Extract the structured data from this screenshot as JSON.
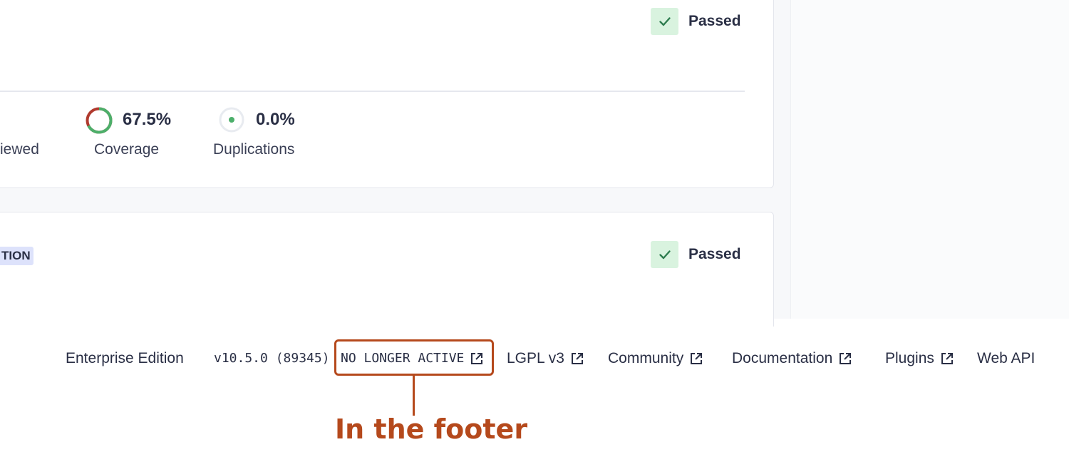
{
  "quality_gate_top": {
    "status": "Passed"
  },
  "metrics": {
    "partial_label": "iewed",
    "coverage": {
      "value": "67.5%",
      "label": "Coverage"
    },
    "duplications": {
      "value": "0.0%",
      "label": "Duplications"
    }
  },
  "quality_gate_bottom": {
    "tag": "TION",
    "status": "Passed"
  },
  "footer": {
    "edition": "Enterprise Edition",
    "version": "v10.5.0 (89345)",
    "no_longer_active": "NO LONGER ACTIVE",
    "links": [
      "LGPL v3",
      "Community",
      "Documentation",
      "Plugins",
      "Web API"
    ]
  },
  "annotation": {
    "callout": "In the footer"
  },
  "colors": {
    "passed_bg": "#d9f3df",
    "passed_check": "#2e7d4f",
    "coverage_good": "#4caf6a",
    "coverage_bad": "#b03a2e",
    "callout": "#b5491c",
    "tag_bg": "#dde2fb"
  },
  "icons": [
    "check-icon",
    "coverage-donut-icon",
    "duplications-ring-icon",
    "external-link-icon"
  ]
}
